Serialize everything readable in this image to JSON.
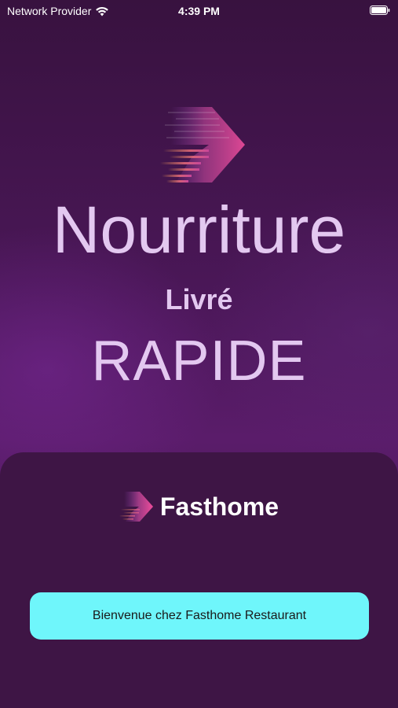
{
  "status_bar": {
    "carrier": "Network Provider",
    "time": "4:39 PM",
    "wifi_icon": "wifi-icon",
    "battery_icon": "battery-icon"
  },
  "hero": {
    "logo_icon": "speed-arrow-logo-icon",
    "title": "Nourriture",
    "subtitle": "Livré",
    "tagline": "RAPIDE"
  },
  "brand": {
    "logo_icon": "speed-arrow-logo-icon",
    "name": "Fasthome"
  },
  "welcome_button": {
    "label": "Bienvenue chez Fasthome Restaurant"
  },
  "colors": {
    "text_light": "#e3c8f0",
    "button_bg": "#6ff6fb",
    "card_bg": "#3e1545",
    "logo_pink": "#e0429a",
    "logo_orange": "#f0a050"
  }
}
